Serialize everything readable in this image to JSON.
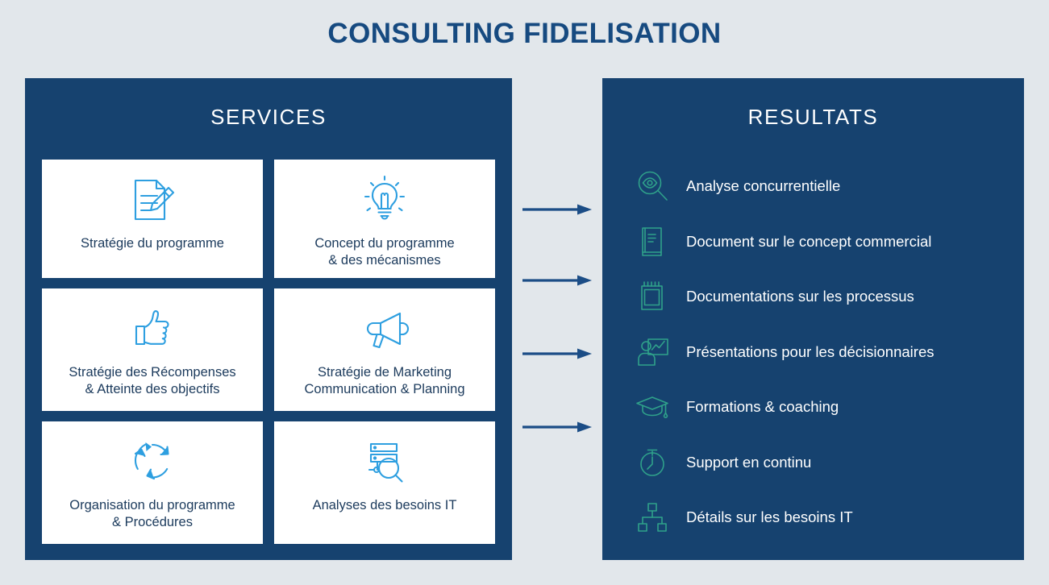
{
  "title": "CONSULTING FIDELISATION",
  "colors": {
    "background": "#e2e7eb",
    "panel": "#16426f",
    "title": "#164a80",
    "service_icon": "#2e9fe0",
    "service_label": "#1b3a5c",
    "result_icon": "#2fa18a",
    "result_label": "#ffffff",
    "arrow": "#1b4d86",
    "card_background": "#ffffff"
  },
  "services": {
    "header": "SERVICES",
    "cards": [
      {
        "icon": "document-pencil-icon",
        "label": "Stratégie du programme"
      },
      {
        "icon": "lightbulb-icon",
        "label": "Concept du programme\n& des mécanismes"
      },
      {
        "icon": "thumbs-up-icon",
        "label": "Stratégie des Récompenses\n& Atteinte des objectifs"
      },
      {
        "icon": "megaphone-icon",
        "label": "Stratégie de Marketing\nCommunication & Planning"
      },
      {
        "icon": "circular-arrows-icon",
        "label": "Organisation du programme\n& Procédures"
      },
      {
        "icon": "server-search-icon",
        "label": "Analyses des besoins IT"
      }
    ]
  },
  "results": {
    "header": "RESULTATS",
    "items": [
      {
        "icon": "eye-magnifier-icon",
        "label": "Analyse concurrentielle"
      },
      {
        "icon": "book-icon",
        "label": "Document sur le concept commercial"
      },
      {
        "icon": "notepad-icon",
        "label": "Documentations sur les processus"
      },
      {
        "icon": "presentation-person-icon",
        "label": "Présentations pour les décisionnaires"
      },
      {
        "icon": "graduation-cap-icon",
        "label": "Formations & coaching"
      },
      {
        "icon": "stopwatch-icon",
        "label": "Support en continu"
      },
      {
        "icon": "org-chart-icon",
        "label": "Détails sur les besoins IT"
      }
    ]
  },
  "arrows": {
    "count": 4,
    "direction": "right",
    "icon": "arrow-right-icon"
  }
}
